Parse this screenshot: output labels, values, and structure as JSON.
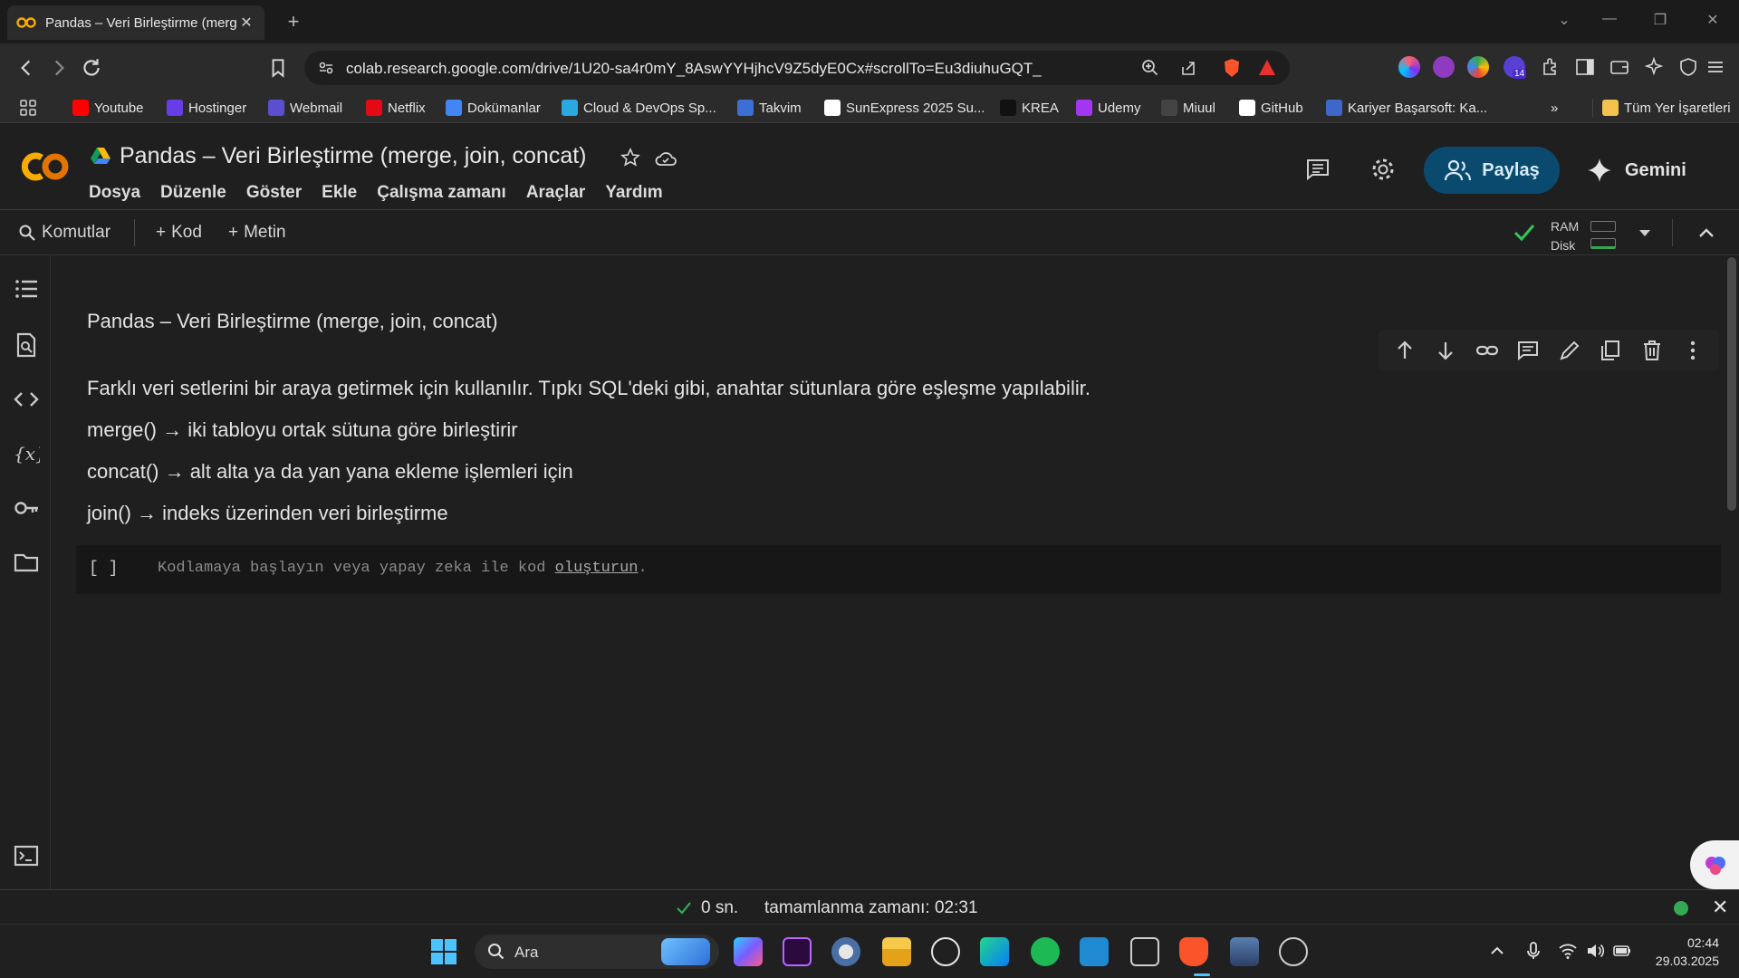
{
  "browser": {
    "tab_title": "Pandas – Veri Birleştirme (merg",
    "url": "colab.research.google.com/drive/1U20-sa4r0mY_8AswYYHjhcV9Z5dyE0Cx#scrollTo=Eu3diuhuGQT_",
    "extension_badge": "14",
    "bookmarks": [
      {
        "label": "Youtube",
        "color": "#ff0000"
      },
      {
        "label": "Hostinger",
        "color": "#673de6"
      },
      {
        "label": "Webmail",
        "color": "#5a4fcf"
      },
      {
        "label": "Netflix",
        "color": "#e50914"
      },
      {
        "label": "Dokümanlar",
        "color": "#4285f4"
      },
      {
        "label": "Cloud & DevOps Sp...",
        "color": "#2aa8e0"
      },
      {
        "label": "Takvim",
        "color": "#3b6fd4"
      },
      {
        "label": "SunExpress 2025 Su...",
        "color": "#ffffff"
      },
      {
        "label": "KREA",
        "color": "#111111"
      },
      {
        "label": "Udemy",
        "color": "#a435f0"
      },
      {
        "label": "Miuul",
        "color": "#444444"
      },
      {
        "label": "GitHub",
        "color": "#ffffff"
      },
      {
        "label": "Kariyer Başarsoft: Ka...",
        "color": "#3f66c9"
      }
    ],
    "all_bookmarks": "Tüm Yer İşaretleri"
  },
  "colab": {
    "notebook_title": "Pandas – Veri Birleştirme (merge, join, concat)",
    "menu": [
      "Dosya",
      "Düzenle",
      "Göster",
      "Ekle",
      "Çalışma zamanı",
      "Araçlar",
      "Yardım"
    ],
    "share_label": "Paylaş",
    "gemini_label": "Gemini",
    "toolbar": {
      "commands": "Komutlar",
      "code": "Kod",
      "text": "Metin"
    },
    "resources": {
      "ram": "RAM",
      "disk": "Disk"
    }
  },
  "text_cell": {
    "heading": "Pandas – Veri Birleştirme (merge, join, concat)",
    "paragraph": "Farklı veri setlerini bir araya getirmek için kullanılır. Tıpkı SQL'deki gibi, anahtar sütunlara göre eşleşme yapılabilir.",
    "lines": [
      "merge() → iki tabloyu ortak sütuna göre birleştirir",
      "concat() → alt alta ya da yan yana ekleme işlemleri için",
      "join() → indeks üzerinden veri birleştirme"
    ]
  },
  "code_cell": {
    "bracket": "[ ]",
    "placeholder_prefix": "Kodlamaya başlayın veya yapay zeka ile kod ",
    "placeholder_link": "oluşturun",
    "placeholder_suffix": "."
  },
  "status": {
    "duration": "0 sn.",
    "completed": "tamamlanma zamanı: 02:31"
  },
  "taskbar": {
    "search_label": "Ara",
    "time": "02:44",
    "date": "29.03.2025"
  }
}
